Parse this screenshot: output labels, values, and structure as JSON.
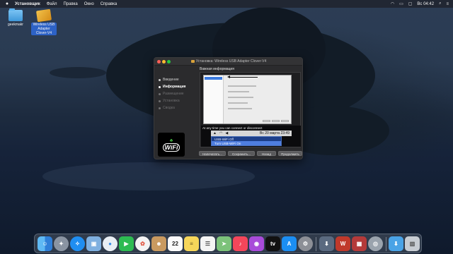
{
  "menubar": {
    "apple_icon": "apple-icon",
    "app_name": "Установщик",
    "menus": [
      "Файл",
      "Правка",
      "Окно",
      "Справка"
    ],
    "time": "Вс 04:42"
  },
  "desktop": {
    "icons": [
      {
        "label": "geekmakr",
        "kind": "folder"
      },
      {
        "label": "Wireless USB Adapter Clover-V4",
        "kind": "package"
      }
    ]
  },
  "installer": {
    "title": "Установка: Wireless USB Adapter Clover-V4",
    "steps": [
      {
        "label": "Введение",
        "state": "done"
      },
      {
        "label": "Информация",
        "state": "active"
      },
      {
        "label": "Размещение",
        "state": "pending"
      },
      {
        "label": "Установка",
        "state": "pending"
      },
      {
        "label": "Сводка",
        "state": "pending"
      }
    ],
    "section_title": "Важная информация",
    "logo_text": "WiFi",
    "screenshot_caption": "At any time you can connect or disconnect",
    "menu_strip_time": "Вс 20 марта 23:49",
    "dropdown_items": [
      "USB-WiFi Off",
      "Turn USB-WiFi On"
    ],
    "buttons": {
      "print": "Напечатать...",
      "save": "Сохранить...",
      "back": "Назад",
      "continue": "Продолжить"
    }
  },
  "dock": {
    "apps": [
      "finder-icon",
      "launchpad-icon",
      "safari-icon",
      "photos-viewer-icon",
      "messages-icon",
      "facetime-icon",
      "photos-icon",
      "contacts-icon",
      "calendar-icon",
      "notes-icon",
      "reminders-icon",
      "maps-icon",
      "music-icon",
      "podcasts-icon",
      "tv-icon",
      "app-store-icon",
      "system-preferences-icon",
      "installer-icon",
      "wifi-utility-icon",
      "photo-booth-icon",
      "disk-utility-icon",
      "downloads-folder-icon",
      "trash-icon"
    ],
    "calendar_day": "22"
  },
  "colors": {
    "accent": "#2d62c6",
    "selection_blue": "#4f7ee0"
  }
}
